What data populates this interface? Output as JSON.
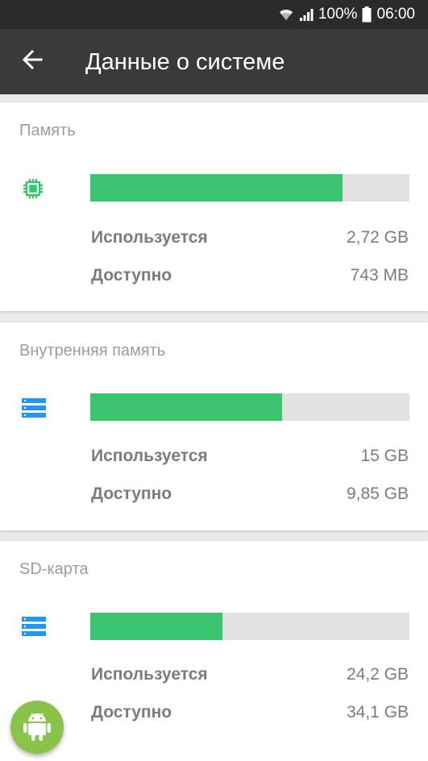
{
  "status_bar": {
    "battery": "100%",
    "time": "06:00",
    "wifi_icon": "wifi-icon",
    "signal_icon": "signal-icon",
    "battery_icon": "battery-icon"
  },
  "app_bar": {
    "title": "Данные о системе",
    "back_icon": "arrow-back-icon"
  },
  "colors": {
    "bar_fill": "#3cc471",
    "bar_track": "#e2e2e2",
    "chip_icon": "#3cc471",
    "storage_icon": "#2196f3",
    "fab": "#8bc34a"
  },
  "cards": [
    {
      "title": "Память",
      "icon": "memory-chip-icon",
      "used_fraction": 0.79,
      "rows": [
        {
          "label": "Используется",
          "value": "2,72 GB"
        },
        {
          "label": "Доступно",
          "value": "743 MB"
        }
      ]
    },
    {
      "title": "Внутренняя память",
      "icon": "storage-icon",
      "used_fraction": 0.6,
      "rows": [
        {
          "label": "Используется",
          "value": "15 GB"
        },
        {
          "label": "Доступно",
          "value": "9,85 GB"
        }
      ]
    },
    {
      "title": "SD-карта",
      "icon": "storage-icon",
      "used_fraction": 0.415,
      "rows": [
        {
          "label": "Используется",
          "value": "24,2 GB"
        },
        {
          "label": "Доступно",
          "value": "34,1 GB"
        }
      ]
    }
  ],
  "fab": {
    "icon": "android-icon"
  }
}
